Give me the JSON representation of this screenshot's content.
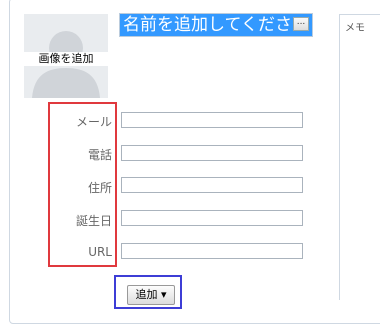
{
  "avatar": {
    "label": "画像を追加"
  },
  "contact": {
    "name": "名前を追加してください",
    "more_label": "..."
  },
  "memo": {
    "placeholder": "メモ"
  },
  "fields": [
    {
      "label": "メール",
      "value": ""
    },
    {
      "label": "電話",
      "value": ""
    },
    {
      "label": "住所",
      "value": ""
    },
    {
      "label": "誕生日",
      "value": ""
    },
    {
      "label": "URL",
      "value": ""
    }
  ],
  "actions": {
    "add_label": "追加 ▾"
  }
}
